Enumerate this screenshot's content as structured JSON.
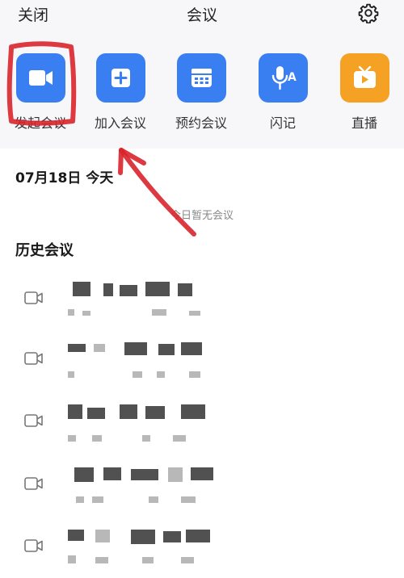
{
  "header": {
    "close_label": "关闭",
    "title": "会议",
    "settings_icon": "gear-icon"
  },
  "actions": [
    {
      "label": "发起会议",
      "icon": "video-camera-icon",
      "color": "#3a7ff2"
    },
    {
      "label": "加入会议",
      "icon": "plus-square-icon",
      "color": "#3a7ff2"
    },
    {
      "label": "预约会议",
      "icon": "calendar-icon",
      "color": "#3a7ff2"
    },
    {
      "label": "闪记",
      "icon": "mic-ai-icon",
      "color": "#3a7ff2"
    },
    {
      "label": "直播",
      "icon": "tv-play-icon",
      "color": "#f5a123"
    }
  ],
  "today": {
    "date_label": "07月18日 今天",
    "empty_text": "今日暂无会议"
  },
  "history": {
    "title": "历史会议",
    "items": [
      {
        "icon": "video-camera-outline-icon"
      },
      {
        "icon": "video-camera-outline-icon"
      },
      {
        "icon": "video-camera-outline-icon"
      },
      {
        "icon": "video-camera-outline-icon"
      },
      {
        "icon": "video-camera-outline-icon"
      }
    ]
  },
  "annotation": {
    "highlight_color": "#d9232b",
    "highlight_target": "发起会议",
    "arrow_color": "#d9232b"
  }
}
